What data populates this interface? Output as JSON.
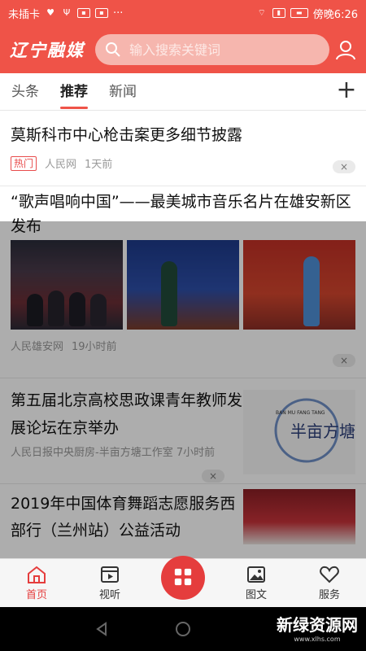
{
  "status_bar": {
    "left_text": "未插卡",
    "icons": [
      "heart-icon",
      "usb-icon",
      "app-notify-icon",
      "app-notify-icon",
      "more-icon"
    ],
    "time": "傍晚6:26"
  },
  "header": {
    "brand": "辽宁融媒",
    "search_placeholder": "输入搜索关键词"
  },
  "tabs": [
    {
      "label": "头条",
      "active": false
    },
    {
      "label": "推荐",
      "active": true
    },
    {
      "label": "新闻",
      "active": false
    }
  ],
  "feed": {
    "items": [
      {
        "title": "莫斯科市中心枪击案更多细节披露",
        "badge": "热门",
        "source": "人民网",
        "time": "1天前"
      },
      {
        "title": "“歌声唱响中国”——最美城市音乐名片在雄安新区发布",
        "source": "人民雄安网",
        "time": "19小时前"
      },
      {
        "title": "第五届北京高校思政课青年教师发展论坛在京举办",
        "source": "人民日报中央厨房-半亩方塘工作室",
        "time": "7小时前",
        "thumb_text": "半亩方塘",
        "thumb_small": "BAN MU FANG TANG"
      },
      {
        "title": "2019年中国体育舞蹈志愿服务西部行（兰州站）公益活动"
      }
    ],
    "close_label": "×"
  },
  "bottom_nav": [
    {
      "label": "首页",
      "icon": "home-icon",
      "active": true
    },
    {
      "label": "视听",
      "icon": "video-icon",
      "active": false
    },
    {
      "label": "",
      "icon": "grid-icon",
      "active": false
    },
    {
      "label": "图文",
      "icon": "image-icon",
      "active": false
    },
    {
      "label": "服务",
      "icon": "heart-icon",
      "active": false
    }
  ],
  "watermark": {
    "text": "新绿资源网",
    "url": "www.xlhs.com"
  },
  "colors": {
    "brand_red": "#ef5348",
    "accent_red": "#e53d3d"
  }
}
